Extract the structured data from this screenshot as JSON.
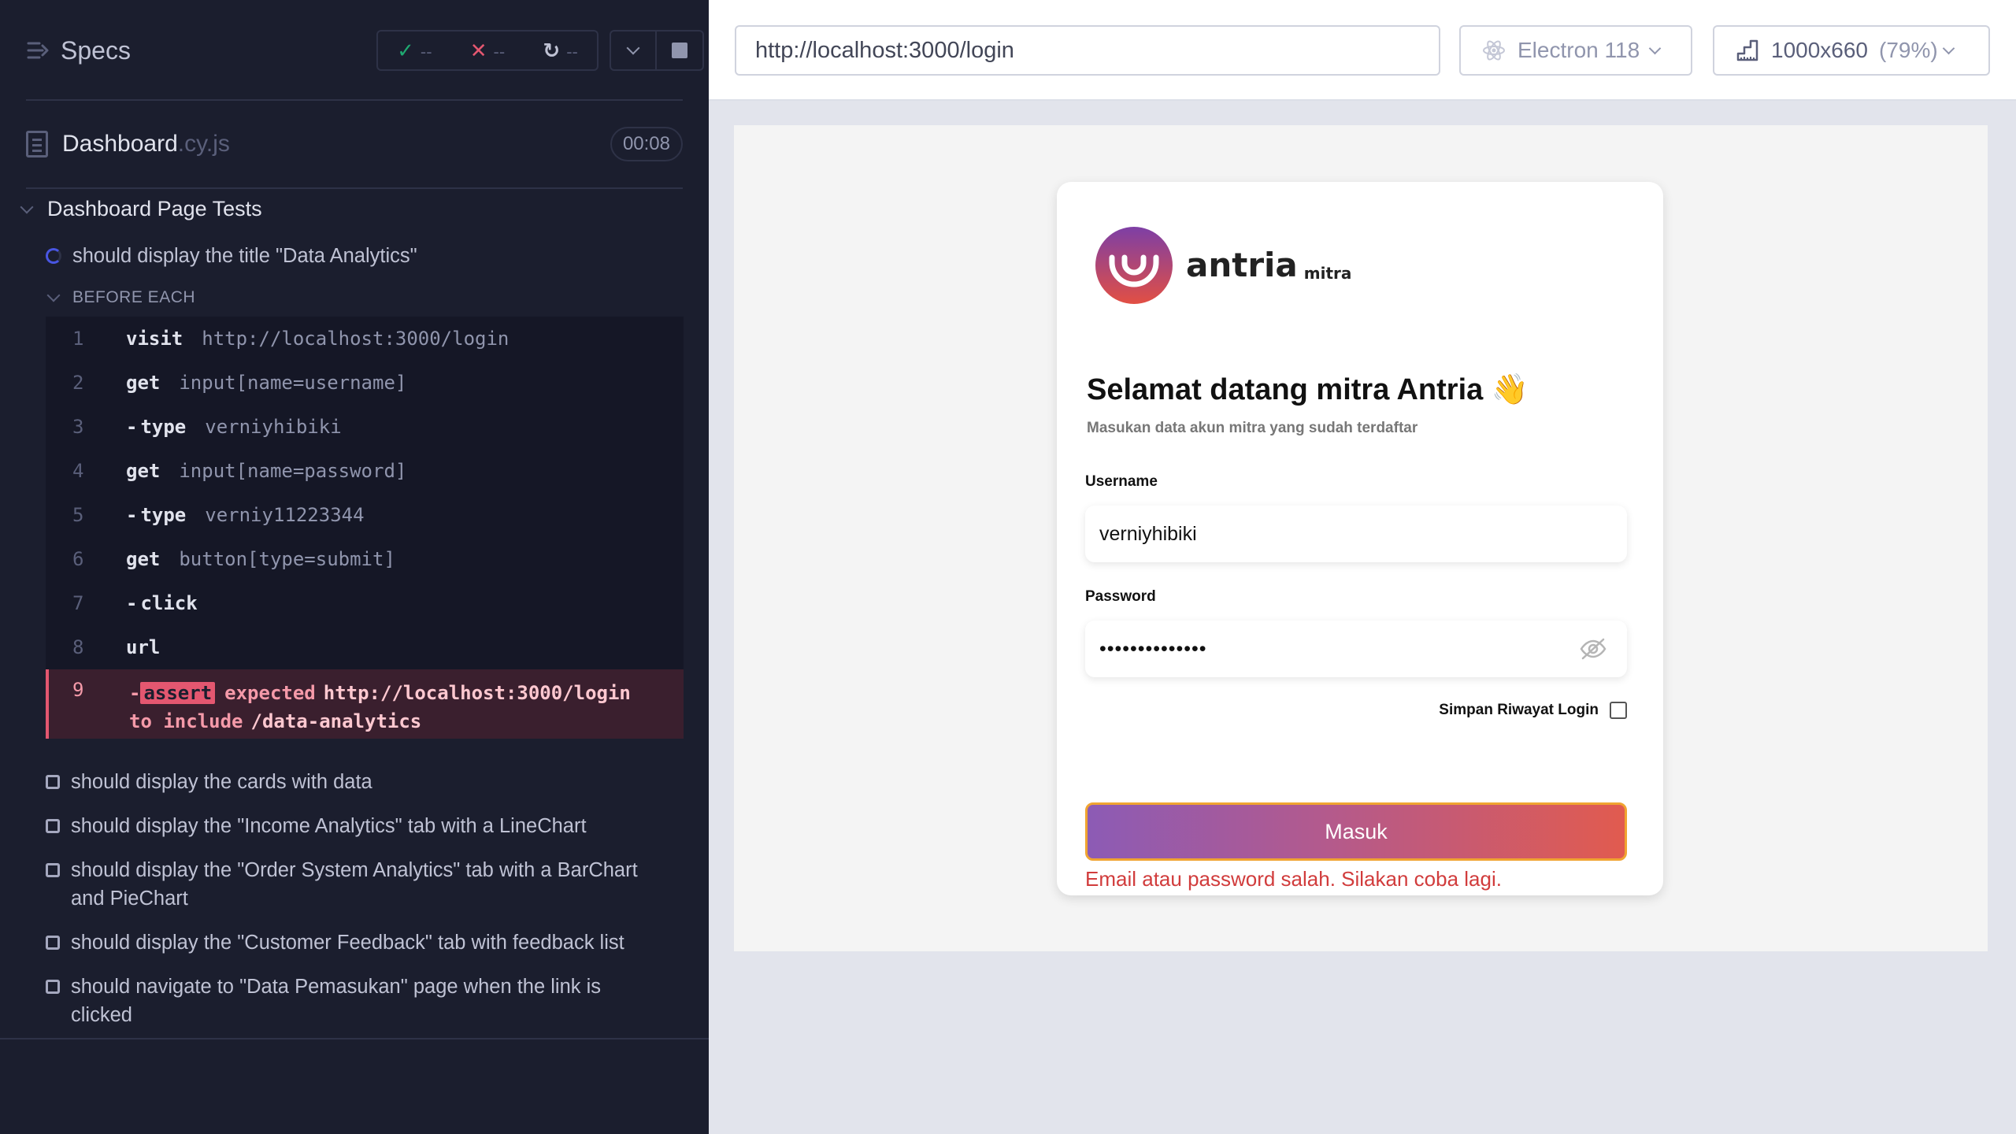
{
  "reporter": {
    "specs_label": "Specs",
    "stats": {
      "passed": "--",
      "failed": "--",
      "pending": "--"
    },
    "spec": {
      "name": "Dashboard",
      "ext": ".cy.js",
      "duration": "00:08"
    },
    "suite_title": "Dashboard Page Tests",
    "running_test": "should display the title \"Data Analytics\"",
    "hook_label": "BEFORE EACH",
    "commands": [
      {
        "num": "1",
        "name": "visit",
        "msg": "http://localhost:3000/login"
      },
      {
        "num": "2",
        "name": "get",
        "msg": "input[name=username]"
      },
      {
        "num": "3",
        "name": "type",
        "msg": "verniyhibiki"
      },
      {
        "num": "4",
        "name": "get",
        "msg": "input[name=password]"
      },
      {
        "num": "5",
        "name": "type",
        "msg": "verniy11223344"
      },
      {
        "num": "6",
        "name": "get",
        "msg": "button[type=submit]"
      },
      {
        "num": "7",
        "name": "click",
        "msg": ""
      },
      {
        "num": "8",
        "name": "url",
        "msg": ""
      }
    ],
    "failed_command": {
      "num": "9",
      "badge": "assert",
      "expected": "expected",
      "actual": "http://localhost:3000/login",
      "to_include": "to include",
      "value": "/data-analytics"
    },
    "pending_tests": [
      "should display the cards with data",
      "should display the \"Income Analytics\" tab with a LineChart",
      "should display the \"Order System Analytics\" tab with a BarChart and PieChart",
      "should display the \"Customer Feedback\" tab with feedback list",
      "should navigate to \"Data Pemasukan\" page when the link is clicked"
    ]
  },
  "aut": {
    "url": "http://localhost:3000/login",
    "browser": "Electron 118",
    "viewport": "1000x660",
    "zoom": "(79%)"
  },
  "login": {
    "logo_word": "antria",
    "logo_sub": "mitra",
    "welcome": "Selamat datang mitra Antria 👋",
    "welcome_sub": "Masukan data akun mitra yang sudah terdaftar",
    "username_label": "Username",
    "username_value": "verniyhibiki",
    "password_label": "Password",
    "password_value": "••••••••••••••",
    "remember_label": "Simpan Riwayat Login",
    "submit_label": "Masuk",
    "error": "Email atau password salah. Silakan coba lagi."
  },
  "colors": {
    "brand_purple": "#8c5bb5",
    "brand_red": "#e15b4f",
    "error": "#d13c3c",
    "fail": "#e45770"
  }
}
